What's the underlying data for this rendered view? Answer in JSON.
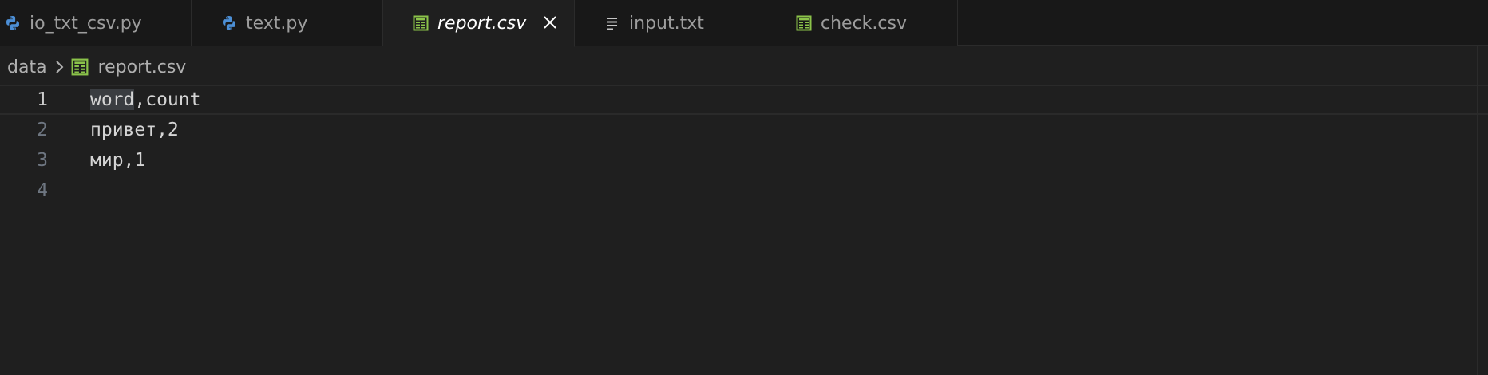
{
  "tabs": [
    {
      "label": "io_txt_csv.py",
      "icon": "python-icon"
    },
    {
      "label": "text.py",
      "icon": "python-icon"
    },
    {
      "label": "report.csv",
      "icon": "csv-file-icon",
      "active": true,
      "close": "close-icon"
    },
    {
      "label": "input.txt",
      "icon": "text-file-icon"
    },
    {
      "label": "check.csv",
      "icon": "csv-file-icon"
    }
  ],
  "breadcrumb": {
    "folder": "data",
    "file": "report.csv"
  },
  "editor": {
    "lines": [
      {
        "number": "1",
        "highlight": "word",
        "rest": ",count"
      },
      {
        "number": "2",
        "text": "привет,2"
      },
      {
        "number": "3",
        "text": "мир,1"
      },
      {
        "number": "4",
        "text": ""
      }
    ]
  },
  "colors": {
    "background": "#1f1f1f",
    "tabbar": "#181818",
    "python_icon": "#4c8fd6",
    "csv_icon": "#8bc34a",
    "text": "#d4d4d4"
  }
}
